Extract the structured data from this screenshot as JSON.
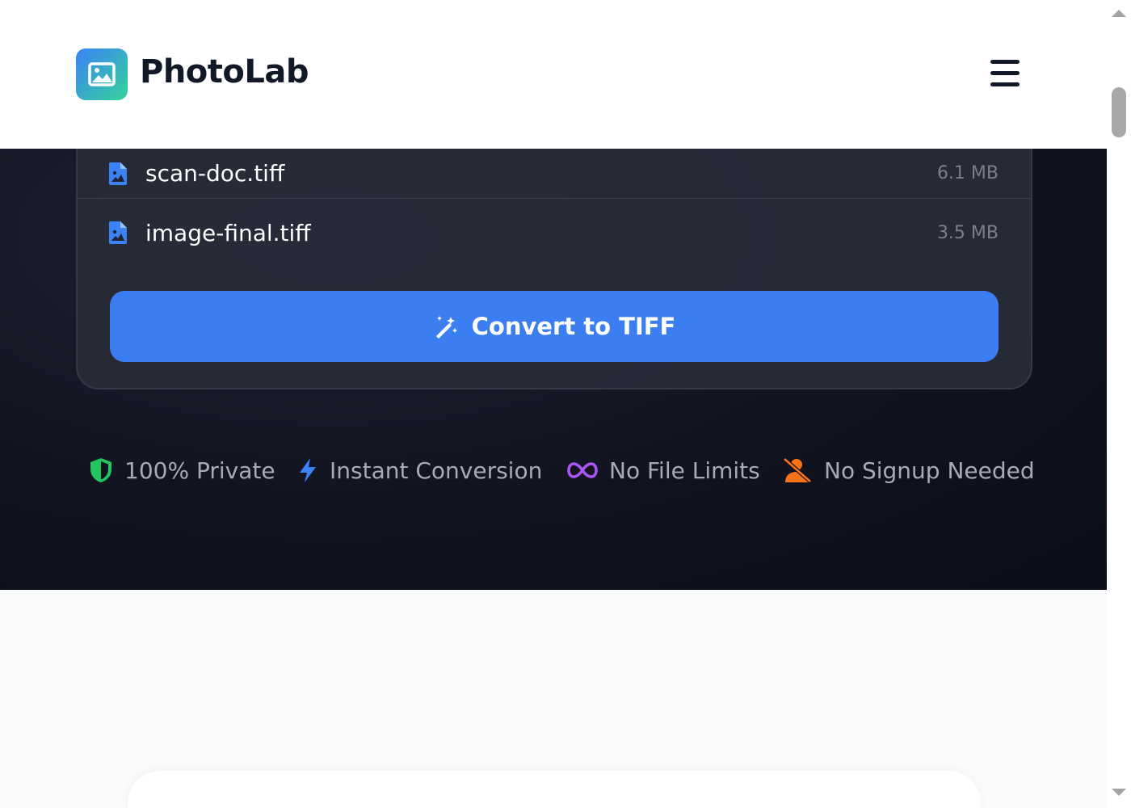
{
  "header": {
    "brand": "PhotoLab",
    "logo_icon": "image-icon",
    "menu_icon": "hamburger-menu-icon"
  },
  "files": [
    {
      "name": "scan-doc.tiff",
      "size": "6.1 MB",
      "icon": "file-image-icon"
    },
    {
      "name": "image-final.tiff",
      "size": "3.5 MB",
      "icon": "file-image-icon"
    }
  ],
  "convert_button": {
    "label": "Convert to TIFF",
    "icon": "magic-wand-icon"
  },
  "features": [
    {
      "label": "100% Private",
      "icon": "shield-icon",
      "color": "#22c55e"
    },
    {
      "label": "Instant Conversion",
      "icon": "lightning-icon",
      "color": "#3b82f6"
    },
    {
      "label": "No File Limits",
      "icon": "infinity-icon",
      "color": "#a855f7"
    },
    {
      "label": "No Signup Needed",
      "icon": "user-slash-icon",
      "color": "#f97316"
    }
  ],
  "colors": {
    "accent": "#3b7ef2",
    "hero_bg": "#11141f",
    "brand_gradient_start": "#3b82f6",
    "brand_gradient_end": "#34d399"
  }
}
